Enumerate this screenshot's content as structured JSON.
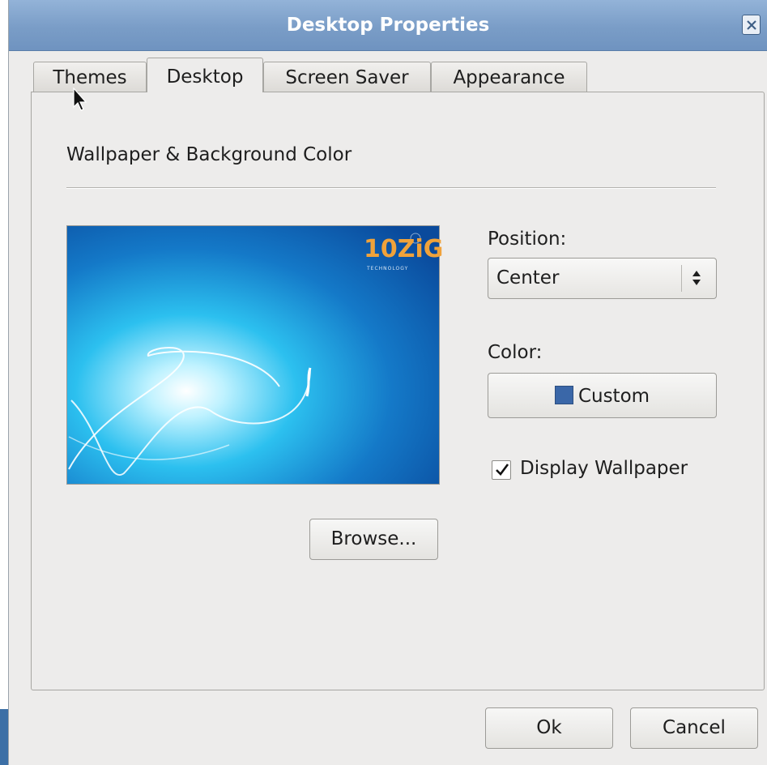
{
  "window": {
    "title": "Desktop Properties"
  },
  "tabs": [
    {
      "label": "Themes",
      "active": false
    },
    {
      "label": "Desktop",
      "active": true
    },
    {
      "label": "Screen Saver",
      "active": false
    },
    {
      "label": "Appearance",
      "active": false
    }
  ],
  "desktop": {
    "section_title": "Wallpaper & Background Color",
    "wallpaper_logo": {
      "text": "10ZiG",
      "subtitle": "TECHNOLOGY"
    },
    "browse_label": "Browse...",
    "position": {
      "label": "Position:",
      "value": "Center"
    },
    "color": {
      "label": "Color:",
      "button_label": "Custom",
      "swatch": "#3a67a8"
    },
    "display_wallpaper": {
      "label": "Display Wallpaper",
      "checked": true
    }
  },
  "footer": {
    "ok_label": "Ok",
    "cancel_label": "Cancel"
  },
  "colors": {
    "titlebar": "#7a9dc7",
    "background": "#edeceb",
    "accent": "#3a67a8"
  }
}
